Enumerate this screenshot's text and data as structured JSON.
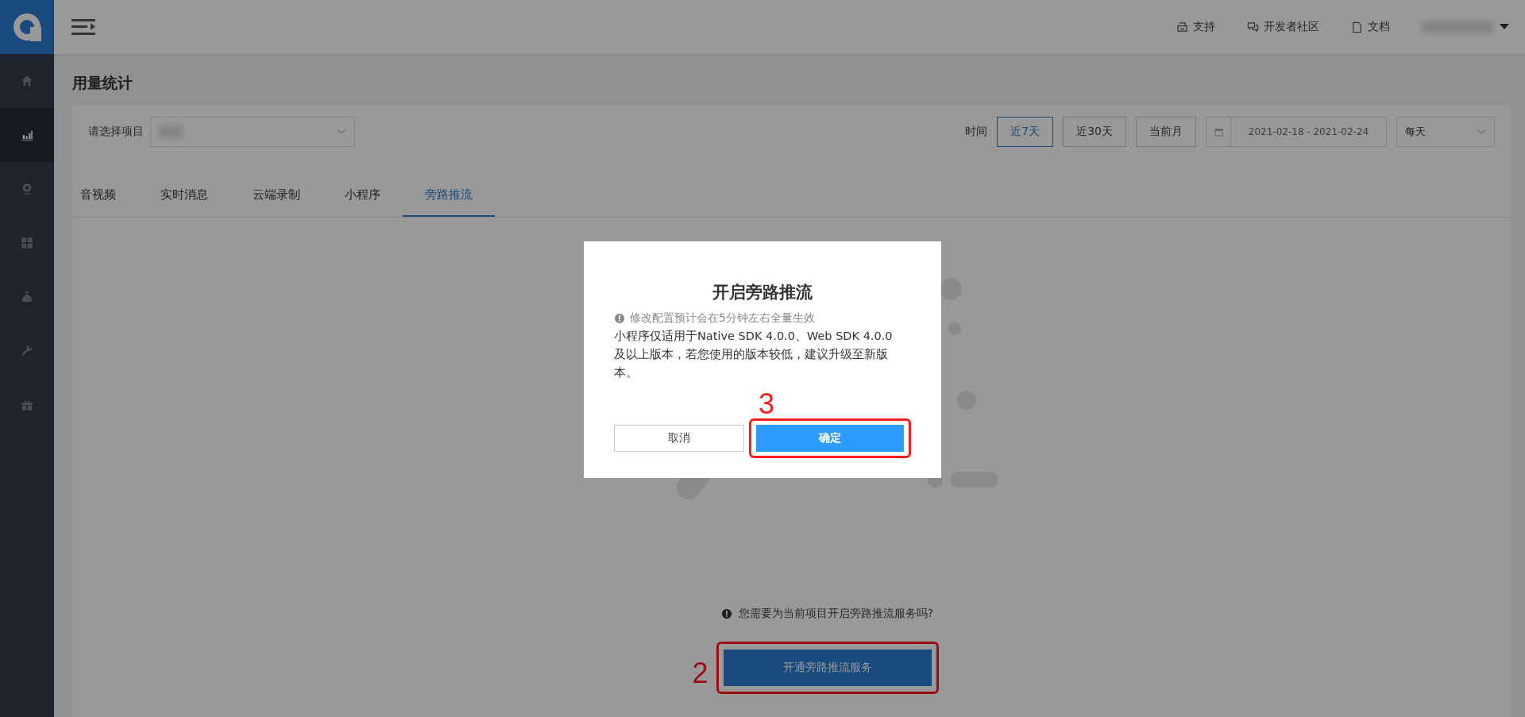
{
  "sidebar": {
    "items": [
      {
        "selected": false
      },
      {
        "selected": true
      },
      {
        "selected": false
      },
      {
        "selected": false
      },
      {
        "selected": false
      },
      {
        "selected": false
      },
      {
        "selected": false
      }
    ]
  },
  "header": {
    "links": [
      {
        "label": "支持"
      },
      {
        "label": "开发者社区"
      },
      {
        "label": "文档"
      }
    ]
  },
  "page_title": "用量统计",
  "filters": {
    "project_label": "请选择项目",
    "time_label": "时间",
    "ranges": [
      {
        "label": "近7天",
        "selected": true
      },
      {
        "label": "近30天",
        "selected": false
      },
      {
        "label": "当前月",
        "selected": false
      }
    ],
    "date_range": "2021-02-18 - 2021-02-24",
    "granularity": "每天"
  },
  "tabs": [
    {
      "label": "音视频",
      "selected": false
    },
    {
      "label": "实时消息",
      "selected": false
    },
    {
      "label": "云端录制",
      "selected": false
    },
    {
      "label": "小程序",
      "selected": false
    },
    {
      "label": "旁路推流",
      "selected": true
    }
  ],
  "notice": "您需要为当前项目开启旁路推流服务吗?",
  "open_button": {
    "label": "开通旁路推流服务",
    "annotation": "2"
  },
  "dialog": {
    "title": "开启旁路推流",
    "warning": "修改配置预计会在5分钟左右全量生效",
    "body": "小程序仅适用于Native SDK 4.0.0、Web SDK 4.0.0及以上版本，若您使用的版本较低，建议升级至新版本。",
    "cancel": "取消",
    "confirm": {
      "label": "确定",
      "annotation": "3"
    }
  }
}
